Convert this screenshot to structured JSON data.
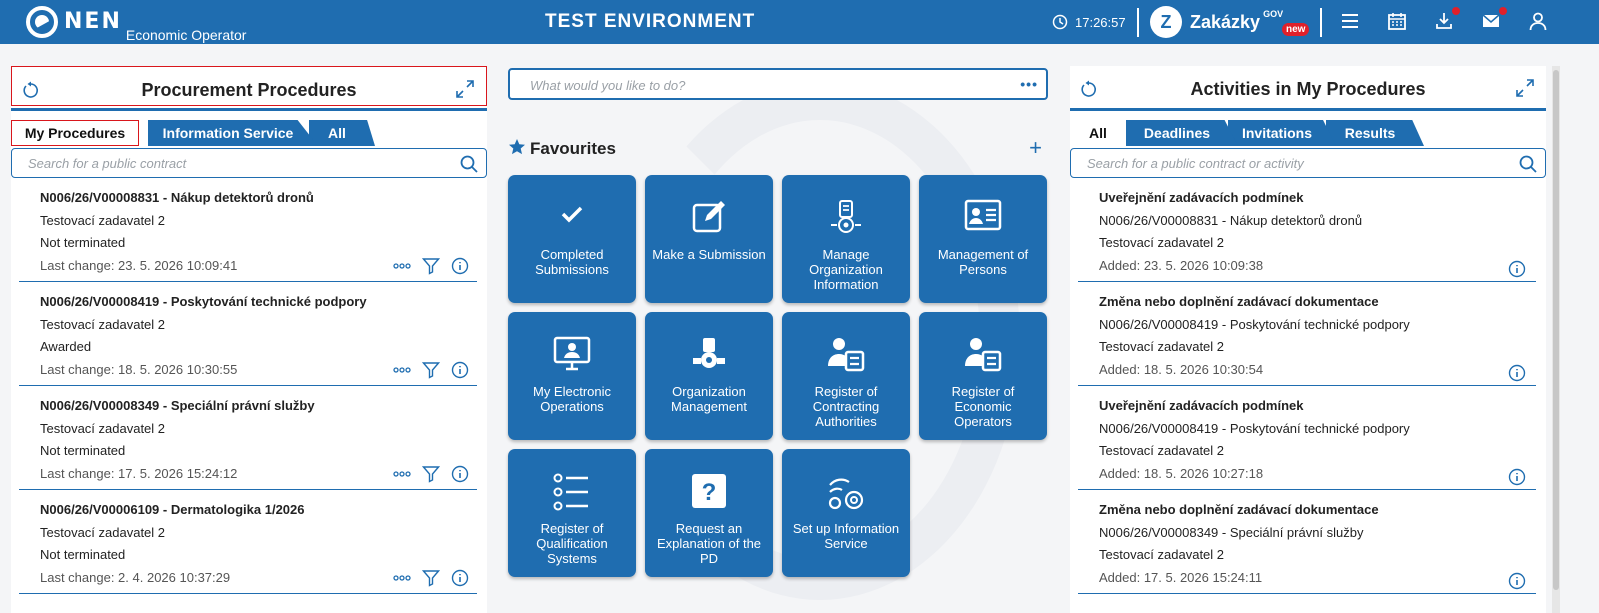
{
  "header": {
    "logo_text": "NEN",
    "logo_sub": "Economic Operator",
    "env_title": "TEST ENVIRONMENT",
    "clock": "17:26:57",
    "zakazky_letter": "Z",
    "zakazky_text": "Zakázky",
    "zakazky_gov": "GOV",
    "zakazky_badge": "new",
    "icons": [
      "menu-icon",
      "calendar-icon",
      "download-icon",
      "mail-icon",
      "user-icon"
    ]
  },
  "left_panel": {
    "title": "Procurement Procedures",
    "tabs": [
      "My Procedures",
      "Information Service",
      "All"
    ],
    "search_placeholder": "Search for a public contract",
    "items": [
      {
        "title": "N006/26/V00008831 - Nákup detektorů dronů",
        "authority": "Testovací zadavatel 2",
        "status": "Not terminated",
        "last_change": "Last change: 23. 5. 2026 10:09:41"
      },
      {
        "title": "N006/26/V00008419 - Poskytování technické podpory",
        "authority": "Testovací zadavatel 2",
        "status": "Awarded",
        "last_change": "Last change: 18. 5. 2026 10:30:55"
      },
      {
        "title": "N006/26/V00008349 - Speciální právní služby",
        "authority": "Testovací zadavatel 2",
        "status": "Not terminated",
        "last_change": "Last change: 17. 5. 2026 15:24:12"
      },
      {
        "title": "N006/26/V00006109 - Dermatologika 1/2026",
        "authority": "Testovací zadavatel 2",
        "status": "Not terminated",
        "last_change": "Last change: 2. 4. 2026 10:37:29"
      }
    ]
  },
  "center": {
    "search_placeholder": "What would you like to do?",
    "more": "•••",
    "fav_title": "Favourites",
    "fav_add": "+",
    "tiles": [
      {
        "label_1": "Completed",
        "label_2": "Submissions",
        "label_3": "",
        "icon": "check-icon"
      },
      {
        "label_1": "Make a Submission",
        "label_2": "",
        "label_3": "",
        "icon": "edit-icon"
      },
      {
        "label_1": "Manage",
        "label_2": "Organization",
        "label_3": "Information",
        "icon": "organization-settings-icon"
      },
      {
        "label_1": "Management of",
        "label_2": "Persons",
        "label_3": "",
        "icon": "id-card-icon"
      },
      {
        "label_1": "My Electronic",
        "label_2": "Operations",
        "label_3": "",
        "icon": "monitor-user-icon"
      },
      {
        "label_1": "Organization",
        "label_2": "Management",
        "label_3": "",
        "icon": "organization-gear-icon"
      },
      {
        "label_1": "Register of",
        "label_2": "Contracting",
        "label_3": "Authorities",
        "icon": "person-register-icon"
      },
      {
        "label_1": "Register of",
        "label_2": "Economic",
        "label_3": "Operators",
        "icon": "person-register-icon"
      },
      {
        "label_1": "Register of",
        "label_2": "Qualification",
        "label_3": "Systems",
        "icon": "list-icon"
      },
      {
        "label_1": "Request an",
        "label_2": "Explanation of the",
        "label_3": "PD",
        "icon": "question-icon"
      },
      {
        "label_1": "Set up Information",
        "label_2": "Service",
        "label_3": "",
        "icon": "broadcast-gear-icon"
      }
    ]
  },
  "right_panel": {
    "title": "Activities in My Procedures",
    "tabs": [
      "All",
      "Deadlines",
      "Invitations",
      "Results"
    ],
    "search_placeholder": "Search for a public contract or activity",
    "items": [
      {
        "title": "Uveřejnění zadávacích podmínek",
        "procedure": "N006/26/V00008831 - Nákup detektorů dronů",
        "authority": "Testovací zadavatel 2",
        "added": "Added: 23. 5. 2026 10:09:38"
      },
      {
        "title": "Změna nebo doplnění zadávací dokumentace",
        "procedure": "N006/26/V00008419 - Poskytování technické podpory",
        "authority": "Testovací zadavatel 2",
        "added": "Added: 18. 5. 2026 10:30:54"
      },
      {
        "title": "Uveřejnění zadávacích podmínek",
        "procedure": "N006/26/V00008419 - Poskytování technické podpory",
        "authority": "Testovací zadavatel 2",
        "added": "Added: 18. 5. 2026 10:27:18"
      },
      {
        "title": "Změna nebo doplnění zadávací dokumentace",
        "procedure": "N006/26/V00008349 - Speciální právní služby",
        "authority": "Testovací zadavatel 2",
        "added": "Added: 17. 5. 2026 15:24:11"
      }
    ]
  },
  "colors": {
    "brand": "#1f6db0",
    "highlight": "#d9161c",
    "badge": "#e0202a"
  }
}
